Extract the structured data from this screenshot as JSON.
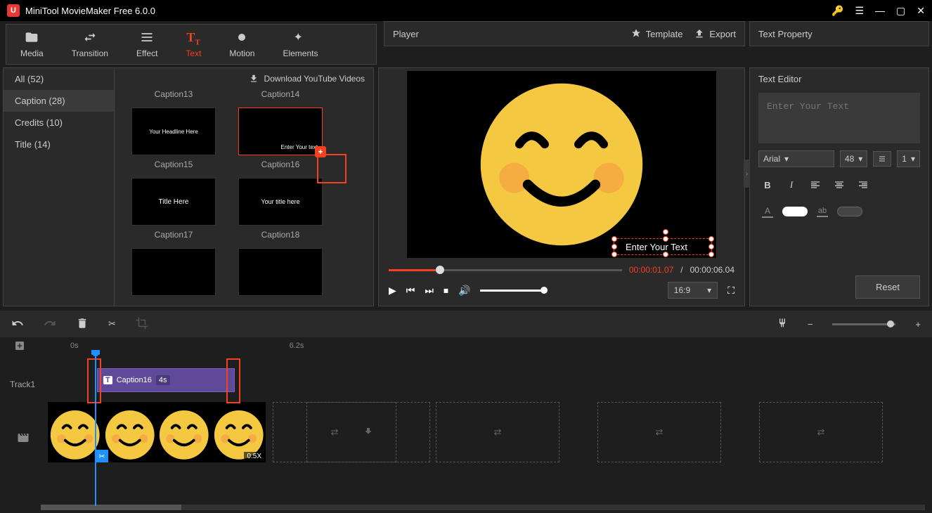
{
  "app": {
    "title": "MiniTool MovieMaker Free 6.0.0"
  },
  "toolbar": {
    "media": "Media",
    "transition": "Transition",
    "effect": "Effect",
    "text": "Text",
    "motion": "Motion",
    "elements": "Elements"
  },
  "library": {
    "sidebar": {
      "all": "All (52)",
      "caption": "Caption (28)",
      "credits": "Credits (10)",
      "title": "Title (14)"
    },
    "download_label": "Download YouTube Videos",
    "thumbs": {
      "c13": "Caption13",
      "c14": "Caption14",
      "c15": "Caption15",
      "c16": "Caption16",
      "c17": "Caption17",
      "c18": "Caption18",
      "t15": "Your Headline Here",
      "t16": "Enter Your text",
      "t17": "Title Here",
      "t18": "Your title here"
    }
  },
  "player": {
    "title": "Player",
    "template": "Template",
    "export": "Export",
    "current": "00:00:01.07",
    "sep": "/",
    "total": "00:00:06.04",
    "aspect": "16:9",
    "placeholder": "Enter Your Text"
  },
  "properties": {
    "title": "Text Property",
    "editor": "Text Editor",
    "placeholder": "Enter Your Text",
    "font": "Arial",
    "size": "48",
    "lineheight": "1",
    "reset": "Reset",
    "ab": "ab"
  },
  "timeline": {
    "t0": "0s",
    "t6": "6.2s",
    "track1": "Track1",
    "caption_name": "Caption16",
    "caption_dur": "4s",
    "speed": "0.5X"
  }
}
